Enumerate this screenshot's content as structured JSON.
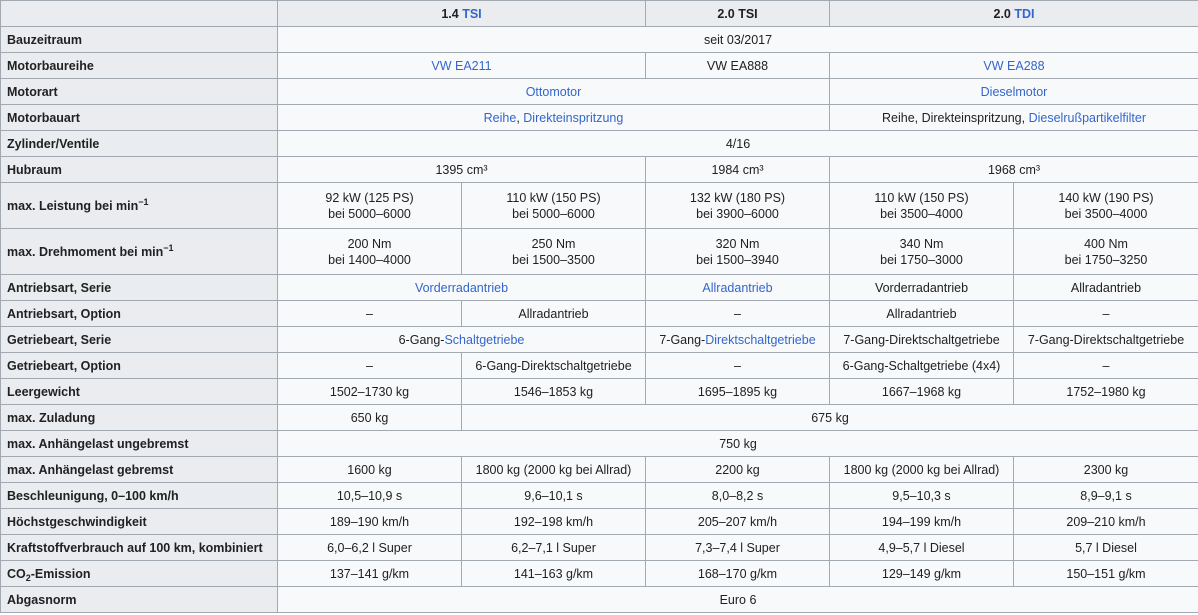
{
  "header": {
    "c1": {
      "prefix": "1.4 ",
      "link": "TSI"
    },
    "c2": "2.0 TSI",
    "c3": {
      "prefix": "2.0 ",
      "link": "TDI"
    }
  },
  "labels": {
    "bauzeitraum": "Bauzeitraum",
    "motorbaureihe": "Motorbaureihe",
    "motorart": "Motorart",
    "motorbauart": "Motorbauart",
    "zylinder": "Zylinder/Ventile",
    "hubraum": "Hubraum",
    "leistung": {
      "text": "max. Leistung bei min",
      "sup": "−1"
    },
    "drehmoment": {
      "text": "max. Drehmoment bei min",
      "sup": "−1"
    },
    "antrieb_serie": "Antriebsart, Serie",
    "antrieb_option": "Antriebsart, Option",
    "getriebe_serie": "Getriebeart, Serie",
    "getriebe_option": "Getriebeart, Option",
    "leergewicht": "Leergewicht",
    "zuladung": "max. Zuladung",
    "anh_ungebremst": "max. Anhängelast ungebremst",
    "anh_gebremst": "max. Anhängelast gebremst",
    "beschleunigung": "Beschleunigung, 0–100 km/h",
    "hoechst": "Höchstgeschwindigkeit",
    "verbrauch": "Kraftstoffverbrauch auf 100 km, kombiniert",
    "co2": {
      "pre": "CO",
      "sub": "2",
      "post": "-Emission"
    },
    "abgasnorm": "Abgasnorm"
  },
  "values": {
    "bauzeitraum": "seit 03/2017",
    "motorbaureihe": [
      "VW EA211",
      "VW EA888",
      "VW EA288"
    ],
    "motorart": [
      "Ottomotor",
      "Dieselmotor"
    ],
    "motorbauart": {
      "otto_a": "Reihe",
      "otto_sep": ", ",
      "otto_b": "Direkteinspritzung",
      "diesel_text": "Reihe, Direkteinspritzung, ",
      "diesel_link": "Dieselrußpartikelfilter"
    },
    "zylinder": "4/16",
    "hubraum": [
      "1395 cm³",
      "1984 cm³",
      "1968 cm³"
    ],
    "leistung": [
      [
        "92 kW (125 PS)",
        "bei 5000–6000"
      ],
      [
        "110 kW (150 PS)",
        "bei 5000–6000"
      ],
      [
        "132 kW (180 PS)",
        "bei 3900–6000"
      ],
      [
        "110 kW (150 PS)",
        "bei 3500–4000"
      ],
      [
        "140 kW (190 PS)",
        "bei 3500–4000"
      ]
    ],
    "drehmoment": [
      [
        "200 Nm",
        "bei 1400–4000"
      ],
      [
        "250 Nm",
        "bei 1500–3500"
      ],
      [
        "320 Nm",
        "bei 1500–3940"
      ],
      [
        "340 Nm",
        "bei 1750–3000"
      ],
      [
        "400 Nm",
        "bei 1750–3250"
      ]
    ],
    "antrieb_serie": [
      "Vorderradantrieb",
      "Allradantrieb",
      "Vorderradantrieb",
      "Allradantrieb"
    ],
    "antrieb_option": [
      "–",
      "Allradantrieb",
      "–",
      "Allradantrieb",
      "–"
    ],
    "getriebe_serie": {
      "a_prefix": "6-Gang-",
      "a_link": "Schaltgetriebe",
      "b_prefix": "7-Gang-",
      "b_link": "Direktschaltgetriebe",
      "c": "7-Gang-Direktschaltgetriebe",
      "d": "7-Gang-Direktschaltgetriebe"
    },
    "getriebe_option": [
      "–",
      "6-Gang-Direktschaltgetriebe",
      "–",
      "6-Gang-Schaltgetriebe (4x4)",
      "–"
    ],
    "leergewicht": [
      "1502–1730 kg",
      "1546–1853 kg",
      "1695–1895 kg",
      "1667–1968 kg",
      "1752–1980 kg"
    ],
    "zuladung": [
      "650 kg",
      "675 kg"
    ],
    "anh_ungebremst": "750 kg",
    "anh_gebremst": [
      "1600 kg",
      "1800 kg (2000 kg bei Allrad)",
      "2200 kg",
      "1800 kg (2000 kg bei Allrad)",
      "2300 kg"
    ],
    "beschleunigung": [
      "10,5–10,9 s",
      "9,6–10,1 s",
      "8,0–8,2 s",
      "9,5–10,3 s",
      "8,9–9,1 s"
    ],
    "hoechst": [
      "189–190 km/h",
      "192–198 km/h",
      "205–207 km/h",
      "194–199 km/h",
      "209–210 km/h"
    ],
    "verbrauch": [
      "6,0–6,2 l Super",
      "6,2–7,1 l Super",
      "7,3–7,4 l Super",
      "4,9–5,7 l Diesel",
      "5,7 l Diesel"
    ],
    "co2": [
      "137–141 g/km",
      "141–163 g/km",
      "168–170 g/km",
      "129–149 g/km",
      "150–151 g/km"
    ],
    "abgasnorm": "Euro 6"
  },
  "colors": {
    "link": "#3366cc",
    "header_bg": "#eaecf0",
    "cell_bg": "#f8f9fa",
    "border": "#a2a9b1"
  }
}
